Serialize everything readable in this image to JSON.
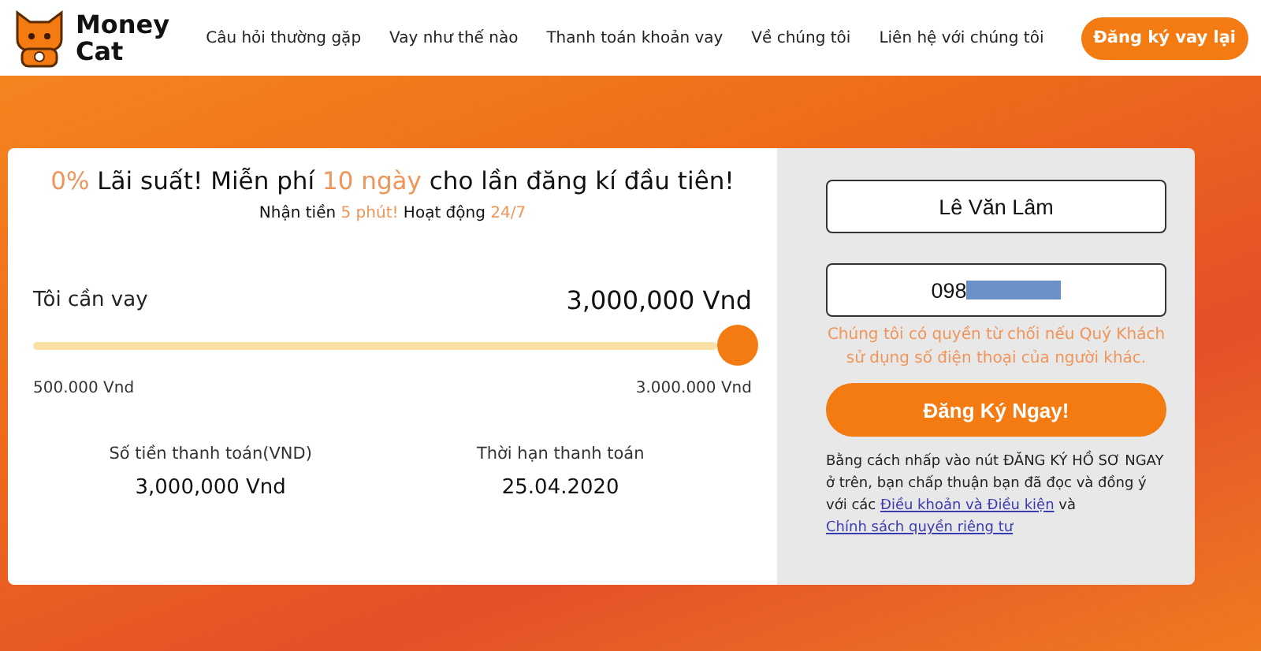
{
  "header": {
    "logo": [
      "Money",
      "Cat"
    ],
    "nav": [
      {
        "label": "Câu hỏi thường gặp"
      },
      {
        "label": "Vay như thế nào"
      },
      {
        "label": "Thanh toán khoản vay"
      },
      {
        "label": "Về chúng tôi"
      },
      {
        "label": "Liên hệ với chúng tôi"
      }
    ],
    "cta": "Đăng ký vay lại"
  },
  "offer": {
    "headline": [
      {
        "text": "0%",
        "accent": true
      },
      {
        "text": " Lãi suất! Miễn phí ",
        "accent": false
      },
      {
        "text": "10 ngày",
        "accent": true
      },
      {
        "text": " cho lần đăng kí đầu tiên!",
        "accent": false
      }
    ],
    "subline": [
      {
        "text": "Nhận tiền ",
        "accent": false
      },
      {
        "text": "5 phút!",
        "accent": true
      },
      {
        "text": " Hoạt động ",
        "accent": false
      },
      {
        "text": "24/7",
        "accent": true
      }
    ],
    "loan_label": "Tôi cần vay",
    "loan_amount": "3,000,000 Vnd",
    "slider": {
      "level": 1,
      "min_label": "500.000 Vnd",
      "max_label": "3.000.000 Vnd"
    },
    "summary": [
      {
        "label": "Số tiền thanh toán(VND)",
        "value": "3,000,000 Vnd"
      },
      {
        "label": "Thời hạn thanh toán",
        "value": "25.04.2020"
      }
    ]
  },
  "form": {
    "name_value": "Lê Văn Lâm",
    "phone_value": "098",
    "phone_redacted": true,
    "warning": "Chúng tôi có quyền từ chối nếu Quý Khách sử dụng số điện thoại của người khác.",
    "submit": "Đăng Ký Ngay!",
    "legal": [
      {
        "text": "Bằng cách nhấp vào nút ĐĂNG KÝ HỒ SƠ NGAY ở trên, bạn chấp thuận bạn đã đọc và đồng ý với các ",
        "kind": "text"
      },
      {
        "text": "Điều khoản và Điều kiện",
        "kind": "link"
      },
      {
        "text": " và ",
        "kind": "text"
      },
      {
        "text": "Chính sách quyền riêng tư",
        "kind": "link"
      }
    ]
  }
}
